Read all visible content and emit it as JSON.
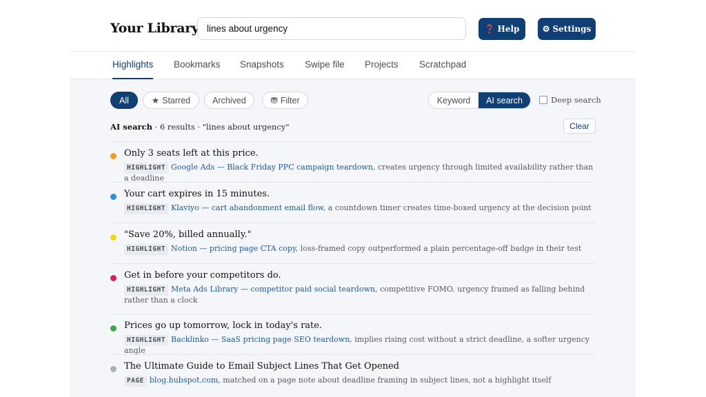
{
  "header": {
    "title": "Your Library",
    "search_value": "lines about urgency",
    "help_label": "Help",
    "help_icon": "❓",
    "settings_label": "Settings",
    "settings_icon": "⚙"
  },
  "tabs": [
    "Highlights",
    "Bookmarks",
    "Snapshots",
    "Swipe file",
    "Projects",
    "Scratchpad"
  ],
  "active_tab": "Highlights",
  "filters": {
    "all": "All",
    "starred": "Starred",
    "archived": "Archived",
    "filter": "Filter",
    "mode_keyword": "Keyword",
    "mode_ai": "AI search",
    "deep_search": "Deep search"
  },
  "summary": {
    "mode": "AI search",
    "rest": " · 6 results · \"lines about urgency\"",
    "clear_label": "Clear"
  },
  "results": [
    {
      "title": "Only 3 seats left at this price.",
      "tag": "HIGHLIGHT",
      "source": "Google Ads — Black Friday PPC campaign teardown",
      "note": ", creates urgency through limited availability rather than a deadline",
      "color": "#f29a1b"
    },
    {
      "title": "Your cart expires in 15 minutes.",
      "tag": "HIGHLIGHT",
      "source": "Klaviyo — cart abandonment email flow",
      "note": ", a countdown timer creates time-boxed urgency at the decision point",
      "color": "#2b8fe0"
    },
    {
      "title": "\"Save 20%, billed annually.\"",
      "tag": "HIGHLIGHT",
      "source": "Notion — pricing page CTA copy",
      "note": ", loss-framed copy outperformed a plain percentage-off badge in their test",
      "color": "#f5d61f"
    },
    {
      "title": "Get in before your competitors do.",
      "tag": "HIGHLIGHT",
      "source": "Meta Ads Library — competitor paid social teardown",
      "note": ", competitive FOMO, urgency framed as falling behind rather than a clock",
      "color": "#dd1f5b"
    },
    {
      "title": "Prices go up tomorrow, lock in today's rate.",
      "tag": "HIGHLIGHT",
      "source": "Backlinko — SaaS pricing page SEO teardown",
      "note": ", implies rising cost without a strict deadline, a softer urgency angle",
      "color": "#3ea84a"
    },
    {
      "title": "The Ultimate Guide to Email Subject Lines That Get Opened",
      "tag": "PAGE",
      "source": "blog.hubspot.com",
      "note": ", matched on a page note about deadline framing in subject lines, not a highlight itself",
      "color": "#aab0b8"
    }
  ],
  "colors": {
    "primary": "#0f3f73",
    "background": "#f4f6f9",
    "link": "#1d5a96"
  }
}
